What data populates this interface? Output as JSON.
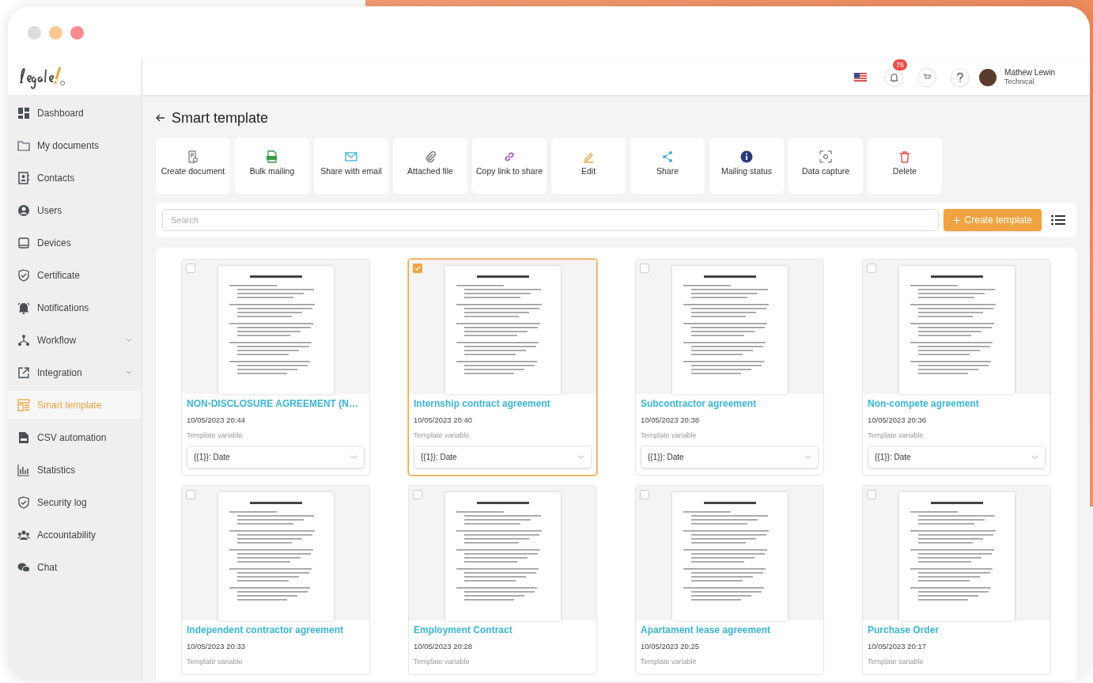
{
  "sidebar": {
    "items": [
      {
        "label": "Dashboard",
        "selected": false,
        "expandable": false
      },
      {
        "label": "My documents",
        "selected": false,
        "expandable": false
      },
      {
        "label": "Contacts",
        "selected": false,
        "expandable": false
      },
      {
        "label": "Users",
        "selected": false,
        "expandable": false
      },
      {
        "label": "Devices",
        "selected": false,
        "expandable": false
      },
      {
        "label": "Certificate",
        "selected": false,
        "expandable": false
      },
      {
        "label": "Notifications",
        "selected": false,
        "expandable": false
      },
      {
        "label": "Workflow",
        "selected": false,
        "expandable": true
      },
      {
        "label": "Integration",
        "selected": false,
        "expandable": true
      },
      {
        "label": "Smart template",
        "selected": true,
        "expandable": false
      },
      {
        "label": "CSV automation",
        "selected": false,
        "expandable": false
      },
      {
        "label": "Statistics",
        "selected": false,
        "expandable": false
      },
      {
        "label": "Security log",
        "selected": false,
        "expandable": false
      },
      {
        "label": "Accountability",
        "selected": false,
        "expandable": false
      },
      {
        "label": "Chat",
        "selected": false,
        "expandable": false
      }
    ]
  },
  "header": {
    "notification_count": "76",
    "user_name": "Mathew Lewin",
    "user_role": "Technical"
  },
  "page_title": "Smart template",
  "actions": [
    "Create document",
    "Bulk mailing",
    "Share with email",
    "Attached file",
    "Copy link to share",
    "Edit",
    "Share",
    "Mailing status",
    "Data capture",
    "Delete"
  ],
  "search": {
    "placeholder": "Search"
  },
  "create_button": "Create template",
  "templates": [
    {
      "title": "NON-DISCLOSURE AGREEMENT (N…",
      "date": "10/05/2023 20:44",
      "variable_label": "Template variable",
      "variable": "{{1}}: Date",
      "selected": false
    },
    {
      "title": "Internship contract agreement",
      "date": "10/05/2023 20:40",
      "variable_label": "Template variable",
      "variable": "{{1}}: Date",
      "selected": true
    },
    {
      "title": "Subcontractor agreement",
      "date": "10/05/2023 20:38",
      "variable_label": "Template variable",
      "variable": "{{1}}: Date",
      "selected": false
    },
    {
      "title": "Non-compete agreement",
      "date": "10/05/2023 20:36",
      "variable_label": "Template variable",
      "variable": "{{1}}: Date",
      "selected": false
    },
    {
      "title": "Independent contractor agreement",
      "date": "10/05/2023 20:33",
      "variable_label": "Template variable",
      "selected": false
    },
    {
      "title": "Employment Contract",
      "date": "10/05/2023 20:28",
      "variable_label": "Template variable",
      "selected": false
    },
    {
      "title": "Apartament lease agreement",
      "date": "10/05/2023 20:25",
      "variable_label": "Template variable",
      "selected": false
    },
    {
      "title": "Purchase Order",
      "date": "10/05/2023 20:17",
      "variable_label": "Template variable",
      "selected": false
    }
  ]
}
